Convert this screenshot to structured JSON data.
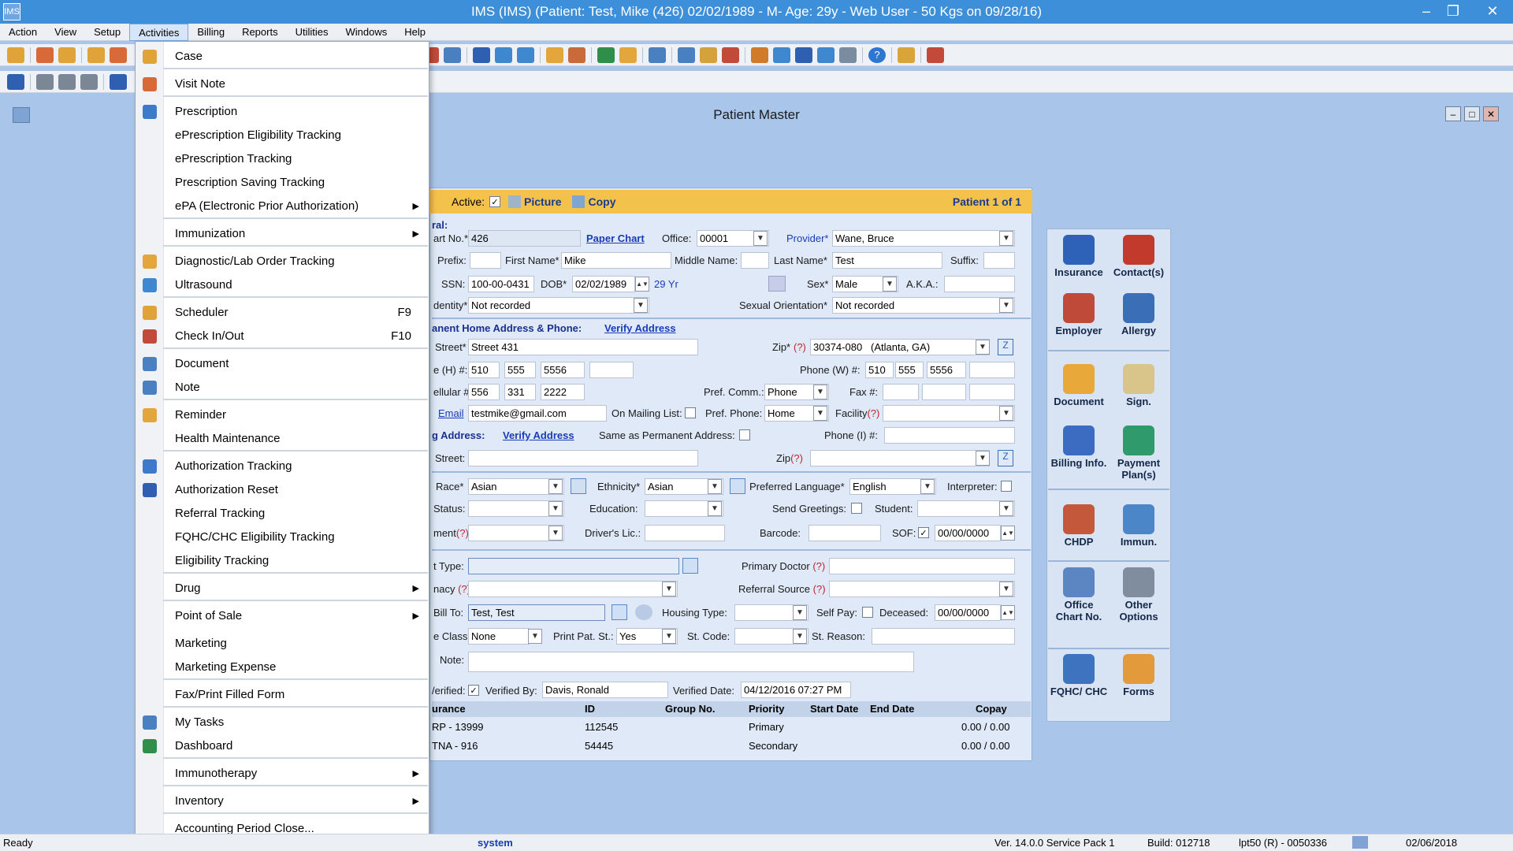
{
  "window": {
    "title": "IMS (IMS)    (Patient: Test, Mike  (426) 02/02/1989 - M- Age: 29y  - Web User - 50 Kgs on 09/28/16)"
  },
  "menubar": [
    "Action",
    "View",
    "Setup",
    "Activities",
    "Billing",
    "Reports",
    "Utilities",
    "Windows",
    "Help"
  ],
  "child_window": {
    "title": "Patient Master"
  },
  "activities_menu": {
    "items": [
      {
        "label": "Case",
        "key": "",
        "submenu": false
      },
      {
        "label": "Visit Note",
        "key": "",
        "submenu": false
      },
      {
        "label": "Prescription",
        "key": "",
        "submenu": false
      },
      {
        "label": "ePrescription Eligibility Tracking",
        "key": "",
        "submenu": false
      },
      {
        "label": "ePrescription Tracking",
        "key": "",
        "submenu": false
      },
      {
        "label": "Prescription Saving Tracking",
        "key": "",
        "submenu": false
      },
      {
        "label": "ePA (Electronic Prior Authorization)",
        "key": "",
        "submenu": true
      },
      {
        "label": "Immunization",
        "key": "",
        "submenu": true
      },
      {
        "label": "Diagnostic/Lab Order Tracking",
        "key": "",
        "submenu": false
      },
      {
        "label": "Ultrasound",
        "key": "",
        "submenu": false
      },
      {
        "label": "Scheduler",
        "key": "F9",
        "submenu": false
      },
      {
        "label": "Check In/Out",
        "key": "F10",
        "submenu": false
      },
      {
        "label": "Document",
        "key": "",
        "submenu": false
      },
      {
        "label": "Note",
        "key": "",
        "submenu": false
      },
      {
        "label": "Reminder",
        "key": "",
        "submenu": false
      },
      {
        "label": "Health Maintenance",
        "key": "",
        "submenu": false
      },
      {
        "label": "Authorization Tracking",
        "key": "",
        "submenu": false
      },
      {
        "label": "Authorization Reset",
        "key": "",
        "submenu": false
      },
      {
        "label": "Referral Tracking",
        "key": "",
        "submenu": false
      },
      {
        "label": "FQHC/CHC Eligibility Tracking",
        "key": "",
        "submenu": false
      },
      {
        "label": "Eligibility Tracking",
        "key": "",
        "submenu": false
      },
      {
        "label": "Drug",
        "key": "",
        "submenu": true
      },
      {
        "label": "Point of Sale",
        "key": "",
        "submenu": true
      },
      {
        "label": "Marketing",
        "key": "",
        "submenu": false
      },
      {
        "label": "Marketing Expense",
        "key": "",
        "submenu": false
      },
      {
        "label": "Fax/Print Filled Form",
        "key": "",
        "submenu": false
      },
      {
        "label": "My Tasks",
        "key": "",
        "submenu": false
      },
      {
        "label": "Dashboard",
        "key": "",
        "submenu": false
      },
      {
        "label": "Immunotherapy",
        "key": "",
        "submenu": true
      },
      {
        "label": "Inventory",
        "key": "",
        "submenu": true
      },
      {
        "label": "Accounting Period Close...",
        "key": "",
        "submenu": false
      }
    ]
  },
  "actbar": {
    "active_label": "Active:",
    "picture": "Picture",
    "copy": "Copy",
    "patient_count": "Patient 1 of 1"
  },
  "general": {
    "section": "ral:",
    "chart_no_label": "art No.*",
    "chart_no": "426",
    "paper_chart": "Paper Chart",
    "office_label": "Office:",
    "office": "00001",
    "provider_label": "Provider*",
    "provider": "Wane, Bruce",
    "prefix_label": "Prefix:",
    "first_label": "First Name*",
    "first": "Mike",
    "middle_label": "Middle Name:",
    "last_label": "Last Name*",
    "last": "Test",
    "suffix_label": "Suffix:",
    "ssn_label": "SSN:",
    "ssn": "100-00-0431",
    "dob_label": "DOB*",
    "dob": "02/02/1989",
    "age": "29 Yr",
    "sex_label": "Sex*",
    "sex": "Male",
    "aka_label": "A.K.A.:",
    "identity_label": "dentity*",
    "identity": "Not recorded",
    "orientation_label": "Sexual Orientation*",
    "orientation": "Not recorded"
  },
  "address": {
    "section": "anent Home Address & Phone:",
    "verify": "Verify Address",
    "street_label": "Street*",
    "street": "Street 431",
    "zip_label": "Zip*",
    "zip_q": "(?)",
    "zip": "30374-080",
    "city": "(Atlanta, GA)",
    "home_label": "e (H) #:",
    "home": [
      "510",
      "555",
      "5556",
      ""
    ],
    "work_label": "Phone (W) #:",
    "work": [
      "510",
      "555",
      "5556",
      ""
    ],
    "cell_label": "ellular #:",
    "cell": [
      "556",
      "331",
      "2222"
    ],
    "pref_comm_label": "Pref. Comm.:",
    "pref_comm": "Phone",
    "fax_label": "Fax #:",
    "email_label": "Email",
    "email": "testmike@gmail.com",
    "mailing_label": "On Mailing List:",
    "pref_phone_label": "Pref. Phone:",
    "pref_phone": "Home",
    "facility_label": "Facility",
    "facility_q": "(?)"
  },
  "mailing": {
    "section": "g Address:",
    "verify": "Verify Address",
    "same_label": "Same as Permanent Address:",
    "phone_i_label": "Phone (I) #:",
    "street_label": "Street:",
    "zip_label": "Zip",
    "zip_q": "(?)"
  },
  "demo": {
    "race_label": "Race*",
    "race": "Asian",
    "ethnicity_label": "Ethnicity*",
    "ethnicity": "Asian",
    "lang_label": "Preferred Language*",
    "lang": "English",
    "interp_label": "Interpreter:",
    "status_label": "Status:",
    "education_label": "Education:",
    "greetings_label": "Send Greetings:",
    "student_label": "Student:",
    "ment_label": "ment",
    "ment_q": "(?)",
    "license_label": "Driver's Lic.:",
    "barcode_label": "Barcode:",
    "sof_label": "SOF:",
    "sof_date": "00/00/0000"
  },
  "other": {
    "type_label": "t Type:",
    "primary_doc_label": "Primary Doctor",
    "q": "(?)",
    "pharmacy_label": "nacy",
    "referral_label": "Referral Source",
    "bill_to_label": "Bill To:",
    "bill_to": "Test, Test",
    "housing_label": "Housing Type:",
    "self_pay_label": "Self Pay:",
    "deceased_label": "Deceased:",
    "deceased": "00/00/0000",
    "class_label": "e Class:",
    "class": "None",
    "print_label": "Print Pat. St.:",
    "print": "Yes",
    "st_code_label": "St. Code:",
    "st_reason_label": "St. Reason:",
    "note_label": "Note:",
    "verified_label": "/erified:",
    "verified_by_label": "Verified By:",
    "verified_by": "Davis, Ronald",
    "verified_date_label": "Verified Date:",
    "verified_date": "04/12/2016 07:27 PM"
  },
  "insurance_grid": {
    "headers": [
      "urance",
      "ID",
      "Group No.",
      "Priority",
      "Start Date",
      "End Date",
      "Copay"
    ],
    "rows": [
      [
        "RP - 13999",
        "112545",
        "",
        "Primary",
        "",
        "",
        "0.00 / 0.00"
      ],
      [
        "TNA - 916",
        "54445",
        "",
        "Secondary",
        "",
        "",
        "0.00 / 0.00"
      ]
    ]
  },
  "side_panel": [
    {
      "label": "Insurance",
      "icon": "insurance-icon",
      "color": "#2d62b8"
    },
    {
      "label": "Contact(s)",
      "icon": "contacts-icon",
      "color": "#c23a2c"
    },
    {
      "label": "Employer",
      "icon": "employer-icon",
      "color": "#c04a3a"
    },
    {
      "label": "Allergy",
      "icon": "allergy-icon",
      "color": "#3a6fb8"
    },
    {
      "label": "Document",
      "icon": "document-icon",
      "color": "#e8a93a"
    },
    {
      "label": "Sign.",
      "icon": "signature-icon",
      "color": "#d9c58a"
    },
    {
      "label": "Billing Info.",
      "icon": "billing-icon",
      "color": "#3b6cc2"
    },
    {
      "label": "Payment Plan(s)",
      "icon": "payment-icon",
      "color": "#2f9a6c"
    },
    {
      "label": "CHDP",
      "icon": "chdp-icon",
      "color": "#c4583a"
    },
    {
      "label": "Immun.",
      "icon": "immunization-icon",
      "color": "#4b86c9"
    },
    {
      "label": "Office Chart No.",
      "icon": "office-chart-icon",
      "color": "#5b86c2"
    },
    {
      "label": "Other Options",
      "icon": "options-icon",
      "color": "#7f8d9e"
    },
    {
      "label": "FQHC/ CHC",
      "icon": "fqhc-icon",
      "color": "#3e74bf"
    },
    {
      "label": "Forms",
      "icon": "forms-icon",
      "color": "#e29a3b"
    }
  ],
  "statusbar": {
    "ready": "Ready",
    "user": "system",
    "version": "Ver. 14.0.0 Service Pack 1",
    "build": "Build: 012718",
    "db": "lpt50 (R) - 0050336",
    "date": "02/06/2018"
  }
}
